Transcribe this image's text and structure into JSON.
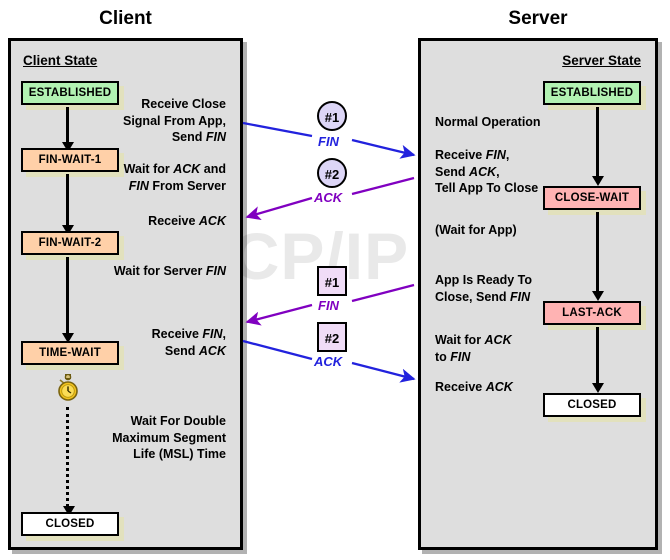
{
  "diagram": {
    "watermark": "The TCP/IP Guide",
    "client_title": "Client",
    "server_title": "Server"
  },
  "client": {
    "state_heading": "Client State",
    "states": [
      {
        "label": "ESTABLISHED",
        "color": "#b2f2b2"
      },
      {
        "label": "FIN-WAIT-1",
        "color": "#ffd0a8"
      },
      {
        "label": "FIN-WAIT-2",
        "color": "#ffd0a8"
      },
      {
        "label": "TIME-WAIT",
        "color": "#ffd0a8"
      },
      {
        "label": "CLOSED",
        "color": "#ffffff"
      }
    ],
    "notes": [
      "Receive Close\nSignal From App,\nSend FIN",
      "Wait for ACK and\nFIN From Server",
      "Receive ACK",
      "Wait for Server FIN",
      "Receive FIN,\nSend ACK",
      "Wait For Double\nMaximum Segment\nLife (MSL) Time"
    ],
    "timer_icon": "stopwatch-icon"
  },
  "server": {
    "state_heading": "Server State",
    "states": [
      {
        "label": "ESTABLISHED",
        "color": "#b2f2b2"
      },
      {
        "label": "CLOSE-WAIT",
        "color": "#ffb3b3"
      },
      {
        "label": "LAST-ACK",
        "color": "#ffb3b3"
      },
      {
        "label": "CLOSED",
        "color": "#ffffff"
      }
    ],
    "notes": [
      "Normal Operation",
      "Receive FIN,\nSend ACK,\nTell App To Close",
      "(Wait for App)",
      "App Is Ready To\nClose, Send FIN",
      "Wait for ACK\nto FIN",
      "Receive ACK"
    ]
  },
  "messages": [
    {
      "marker": "#1",
      "label": "FIN",
      "shape": "circle",
      "color": "#2222dd",
      "direction": "client-to-server"
    },
    {
      "marker": "#2",
      "label": "ACK",
      "shape": "circle",
      "color": "#8000c0",
      "direction": "server-to-client"
    },
    {
      "marker": "#1",
      "label": "FIN",
      "shape": "square",
      "color": "#8000c0",
      "direction": "server-to-client"
    },
    {
      "marker": "#2",
      "label": "ACK",
      "shape": "square",
      "color": "#2222dd",
      "direction": "client-to-server"
    }
  ],
  "colors": {
    "panel_bg": "#dedede",
    "established": "#b2f2b2",
    "finwait": "#ffd0a8",
    "closewait": "#ffb3b3",
    "blue_arrow": "#2222dd",
    "purple_arrow": "#8000c0",
    "shadow": "#e2e1bd"
  }
}
